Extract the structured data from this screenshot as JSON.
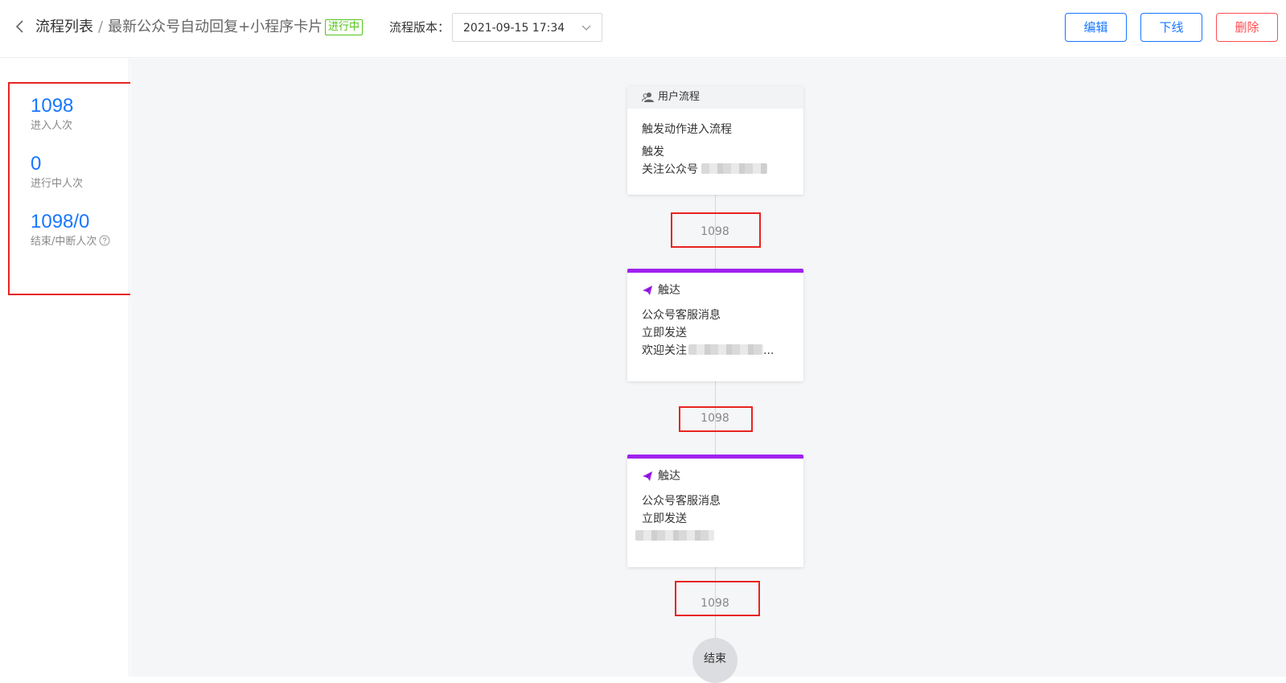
{
  "header": {
    "breadcrumb_root": "流程列表",
    "breadcrumb_sep": "/",
    "breadcrumb_current": "最新公众号自动回复+小程序卡片",
    "status_badge": "进行中",
    "version_label": "流程版本：",
    "version_value": "2021-09-15 17:34",
    "edit_label": "编辑",
    "offline_label": "下线",
    "delete_label": "删除"
  },
  "stats": {
    "entered": {
      "value": "1098",
      "label": "进入人次"
    },
    "in_progress": {
      "value": "0",
      "label": "进行中人次"
    },
    "ended": {
      "value": "1098/0",
      "label": "结束/中断人次"
    }
  },
  "flow": {
    "start_node": {
      "header": "用户流程",
      "title": "触发动作进入流程",
      "line1": "触发",
      "line2": "关注公众号"
    },
    "count_1": "1098",
    "touch_node_1": {
      "title": "触达",
      "line1": "公众号客服消息",
      "line2": "立即发送",
      "line3": "欢迎关注",
      "line3_suffix": "..."
    },
    "count_2": "1098",
    "touch_node_2": {
      "title": "触达",
      "line1": "公众号客服消息",
      "line2": "立即发送"
    },
    "count_3": "1098",
    "end_node": "结束"
  },
  "colors": {
    "accent": "#1677ff",
    "danger": "#ff4d4f",
    "success": "#52c41a",
    "touch_bar": "#a020f0",
    "highlight": "#e8231f"
  },
  "icons": [
    "back-icon",
    "chevron-down-icon",
    "help-icon",
    "user-group-icon",
    "paper-plane-icon"
  ]
}
